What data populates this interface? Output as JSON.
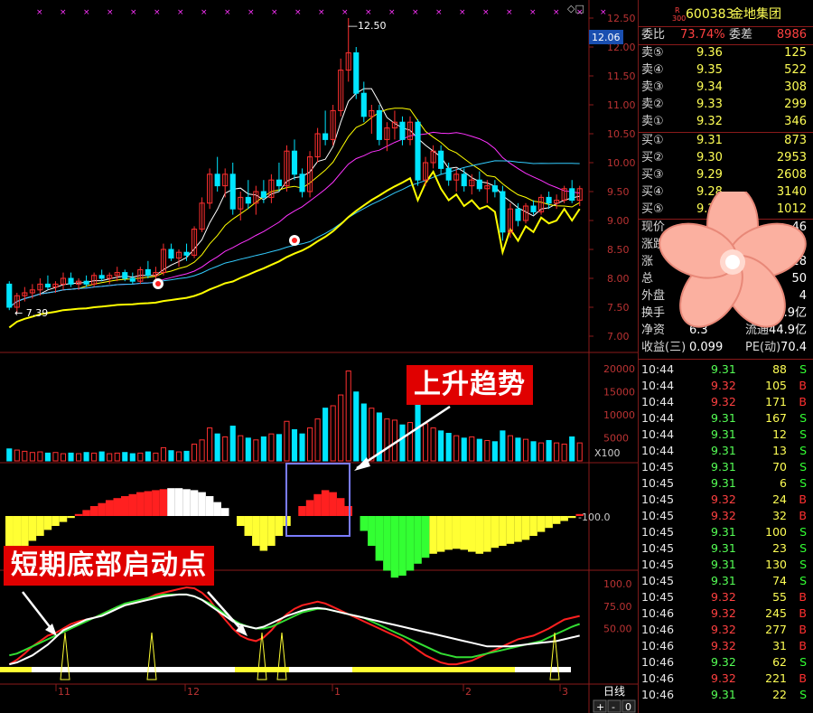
{
  "header": {
    "r_label": "R",
    "code_prefix": "300",
    "code": "600383",
    "name": "金地集团"
  },
  "order_ratio": {
    "label1": "委比",
    "value1": "73.74%",
    "label2": "委差",
    "value2": "8986"
  },
  "sell": [
    {
      "label": "卖⑤",
      "price": "9.36",
      "vol": "125"
    },
    {
      "label": "卖④",
      "price": "9.35",
      "vol": "522"
    },
    {
      "label": "卖③",
      "price": "9.34",
      "vol": "308"
    },
    {
      "label": "卖②",
      "price": "9.33",
      "vol": "299"
    },
    {
      "label": "卖①",
      "price": "9.32",
      "vol": "346"
    }
  ],
  "buy": [
    {
      "label": "买①",
      "price": "9.31",
      "vol": "873"
    },
    {
      "label": "买②",
      "price": "9.30",
      "vol": "2953"
    },
    {
      "label": "买③",
      "price": "9.29",
      "vol": "2608"
    },
    {
      "label": "买④",
      "price": "9.28",
      "vol": "3140"
    },
    {
      "label": "买⑤",
      "price": "9.27",
      "vol": "1012"
    }
  ],
  "quote": [
    {
      "l1": "现价",
      "v1": "",
      "l2": "",
      "v2": "46"
    },
    {
      "l1": "涨跌",
      "v1": "",
      "l2": "",
      "v2": "9.51"
    },
    {
      "l1": "涨",
      "v1": "",
      "l2": "",
      "v2": "9.28"
    },
    {
      "l1": "总",
      "v1": "",
      "l2": "",
      "v2": "50"
    },
    {
      "l1": "外盘",
      "v1": "7",
      "l2": "",
      "v2": "4"
    },
    {
      "l1": "换手",
      "v1": "0.",
      "l2": "本",
      "v2": "44.9亿"
    },
    {
      "l1": "净资",
      "v1": "6.3",
      "l2": "流通",
      "v2": "44.9亿"
    },
    {
      "l1": "收益(三)",
      "v1": "0.099",
      "l2": "PE(动)",
      "v2": "70.4"
    }
  ],
  "ticks": [
    {
      "time": "10:44",
      "price": "9.31",
      "vol": "88",
      "dir": "S"
    },
    {
      "time": "10:44",
      "price": "9.32",
      "vol": "105",
      "dir": "B"
    },
    {
      "time": "10:44",
      "price": "9.32",
      "vol": "171",
      "dir": "B"
    },
    {
      "time": "10:44",
      "price": "9.31",
      "vol": "167",
      "dir": "S"
    },
    {
      "time": "10:44",
      "price": "9.31",
      "vol": "12",
      "dir": "S"
    },
    {
      "time": "10:44",
      "price": "9.31",
      "vol": "13",
      "dir": "S"
    },
    {
      "time": "10:45",
      "price": "9.31",
      "vol": "70",
      "dir": "S"
    },
    {
      "time": "10:45",
      "price": "9.31",
      "vol": "6",
      "dir": "S"
    },
    {
      "time": "10:45",
      "price": "9.32",
      "vol": "24",
      "dir": "B"
    },
    {
      "time": "10:45",
      "price": "9.32",
      "vol": "32",
      "dir": "B"
    },
    {
      "time": "10:45",
      "price": "9.31",
      "vol": "100",
      "dir": "S"
    },
    {
      "time": "10:45",
      "price": "9.31",
      "vol": "23",
      "dir": "S"
    },
    {
      "time": "10:45",
      "price": "9.31",
      "vol": "130",
      "dir": "S"
    },
    {
      "time": "10:45",
      "price": "9.31",
      "vol": "74",
      "dir": "S"
    },
    {
      "time": "10:45",
      "price": "9.32",
      "vol": "55",
      "dir": "B"
    },
    {
      "time": "10:46",
      "price": "9.32",
      "vol": "245",
      "dir": "B"
    },
    {
      "time": "10:46",
      "price": "9.32",
      "vol": "277",
      "dir": "B"
    },
    {
      "time": "10:46",
      "price": "9.32",
      "vol": "31",
      "dir": "B"
    },
    {
      "time": "10:46",
      "price": "9.32",
      "vol": "62",
      "dir": "S"
    },
    {
      "time": "10:46",
      "price": "9.32",
      "vol": "221",
      "dir": "B"
    },
    {
      "time": "10:46",
      "price": "9.31",
      "vol": "22",
      "dir": "S"
    }
  ],
  "colors": {
    "up": "#ff3030",
    "down": "#00e5ff",
    "sell_dir": "#33ff33",
    "buy_dir": "#ff3030",
    "banner": "#e00000"
  },
  "chart_labels": {
    "high_label": "12.50",
    "low_label": "7.39",
    "current_price": "12.06",
    "vol_unit": "X100",
    "macd_level": "-100.0",
    "period_label": "日线",
    "zoom_plus": "+",
    "zoom_minus": "-",
    "zoom_zero": "0",
    "window_icons": "◇□"
  },
  "annotations": {
    "uptrend": "上升趋势",
    "short_bottom": "短期底部启动点"
  },
  "chart_data": [
    {
      "type": "candlestick",
      "yticks": [
        "12.50",
        "12.00",
        "11.50",
        "11.00",
        "10.50",
        "10.00",
        "9.50",
        "9.00",
        "8.50",
        "8.00",
        "7.50",
        "7.00"
      ],
      "ylim": [
        7.0,
        12.5
      ],
      "xticks": [
        "11",
        "12",
        "1",
        "2",
        "3"
      ],
      "ohlc": [
        [
          7.9,
          7.95,
          7.45,
          7.5
        ],
        [
          7.5,
          7.75,
          7.4,
          7.7
        ],
        [
          7.7,
          7.85,
          7.6,
          7.75
        ],
        [
          7.75,
          7.9,
          7.65,
          7.8
        ],
        [
          7.8,
          8.0,
          7.7,
          7.9
        ],
        [
          7.9,
          8.05,
          7.8,
          7.85
        ],
        [
          7.85,
          7.95,
          7.75,
          7.9
        ],
        [
          7.9,
          8.1,
          7.8,
          8.0
        ],
        [
          8.0,
          8.1,
          7.85,
          7.9
        ],
        [
          7.9,
          8.0,
          7.8,
          7.95
        ],
        [
          7.95,
          8.05,
          7.85,
          7.9
        ],
        [
          7.9,
          8.1,
          7.85,
          8.05
        ],
        [
          8.05,
          8.15,
          7.95,
          8.0
        ],
        [
          8.0,
          8.1,
          7.9,
          8.05
        ],
        [
          8.05,
          8.2,
          7.95,
          8.1
        ],
        [
          8.1,
          8.15,
          7.95,
          8.0
        ],
        [
          8.0,
          8.1,
          7.9,
          7.95
        ],
        [
          7.95,
          8.2,
          7.9,
          8.15
        ],
        [
          8.15,
          8.3,
          8.0,
          8.05
        ],
        [
          8.05,
          8.2,
          7.95,
          8.1
        ],
        [
          8.1,
          8.6,
          8.05,
          8.5
        ],
        [
          8.5,
          8.6,
          8.3,
          8.35
        ],
        [
          8.35,
          8.5,
          8.2,
          8.45
        ],
        [
          8.45,
          8.6,
          8.3,
          8.4
        ],
        [
          8.4,
          8.9,
          8.35,
          8.85
        ],
        [
          8.85,
          9.4,
          8.8,
          9.3
        ],
        [
          9.3,
          9.9,
          9.2,
          9.8
        ],
        [
          9.8,
          10.1,
          9.5,
          9.6
        ],
        [
          9.6,
          9.9,
          9.4,
          9.8
        ],
        [
          9.8,
          10.0,
          9.1,
          9.2
        ],
        [
          9.2,
          9.5,
          9.0,
          9.4
        ],
        [
          9.4,
          9.7,
          9.2,
          9.3
        ],
        [
          9.3,
          9.6,
          9.1,
          9.5
        ],
        [
          9.5,
          9.7,
          9.3,
          9.4
        ],
        [
          9.4,
          9.8,
          9.3,
          9.7
        ],
        [
          9.7,
          10.0,
          9.5,
          9.6
        ],
        [
          9.6,
          10.3,
          9.5,
          10.2
        ],
        [
          10.2,
          10.4,
          9.7,
          9.8
        ],
        [
          9.8,
          9.9,
          9.4,
          9.5
        ],
        [
          9.5,
          10.2,
          9.4,
          10.1
        ],
        [
          10.1,
          10.6,
          10.0,
          10.5
        ],
        [
          10.5,
          10.9,
          10.3,
          10.4
        ],
        [
          10.4,
          11.0,
          10.3,
          10.9
        ],
        [
          10.9,
          11.8,
          10.8,
          11.6
        ],
        [
          11.6,
          12.5,
          11.4,
          11.9
        ],
        [
          11.9,
          12.0,
          11.1,
          11.2
        ],
        [
          11.2,
          11.4,
          10.7,
          10.8
        ],
        [
          10.8,
          11.0,
          10.5,
          10.9
        ],
        [
          10.9,
          11.0,
          10.3,
          10.4
        ],
        [
          10.4,
          10.7,
          10.2,
          10.6
        ],
        [
          10.6,
          10.9,
          10.4,
          10.7
        ],
        [
          10.7,
          10.8,
          10.3,
          10.4
        ],
        [
          10.4,
          10.8,
          10.3,
          10.7
        ],
        [
          10.7,
          10.75,
          9.6,
          9.7
        ],
        [
          9.7,
          10.1,
          9.6,
          10.0
        ],
        [
          10.0,
          10.3,
          9.9,
          10.2
        ],
        [
          10.2,
          10.3,
          9.8,
          9.9
        ],
        [
          9.9,
          10.0,
          9.6,
          9.7
        ],
        [
          9.7,
          9.9,
          9.5,
          9.8
        ],
        [
          9.8,
          9.9,
          9.5,
          9.6
        ],
        [
          9.6,
          9.8,
          9.45,
          9.7
        ],
        [
          9.7,
          9.85,
          9.5,
          9.55
        ],
        [
          9.55,
          9.7,
          9.3,
          9.6
        ],
        [
          9.6,
          9.7,
          9.4,
          9.5
        ],
        [
          9.5,
          9.6,
          8.65,
          8.8
        ],
        [
          8.8,
          9.3,
          8.7,
          9.2
        ],
        [
          9.2,
          9.3,
          8.9,
          9.0
        ],
        [
          9.0,
          9.3,
          8.95,
          9.25
        ],
        [
          9.25,
          9.35,
          9.1,
          9.15
        ],
        [
          9.15,
          9.45,
          9.1,
          9.4
        ],
        [
          9.4,
          9.5,
          9.2,
          9.3
        ],
        [
          9.3,
          9.45,
          9.2,
          9.35
        ],
        [
          9.35,
          9.6,
          9.3,
          9.55
        ],
        [
          9.55,
          9.7,
          9.3,
          9.35
        ],
        [
          9.35,
          9.6,
          9.25,
          9.55
        ]
      ],
      "volume": [
        20,
        18,
        16,
        14,
        15,
        13,
        14,
        12,
        13,
        12,
        14,
        13,
        15,
        12,
        13,
        14,
        12,
        13,
        15,
        13,
        22,
        17,
        15,
        16,
        28,
        35,
        55,
        45,
        40,
        58,
        42,
        38,
        35,
        40,
        45,
        44,
        66,
        52,
        45,
        55,
        70,
        88,
        92,
        110,
        150,
        115,
        95,
        88,
        80,
        70,
        68,
        60,
        64,
        100,
        62,
        55,
        50,
        46,
        42,
        38,
        40,
        36,
        34,
        32,
        50,
        42,
        38,
        36,
        32,
        30,
        34,
        30,
        28,
        40,
        30
      ],
      "macd_hist": [
        -0.3,
        -0.32,
        -0.3,
        -0.25,
        -0.2,
        -0.14,
        -0.1,
        -0.06,
        -0.02,
        0.02,
        0.06,
        0.1,
        0.13,
        0.16,
        0.18,
        0.2,
        0.22,
        0.24,
        0.25,
        0.26,
        0.27,
        0.28,
        0.28,
        0.27,
        0.26,
        0.24,
        0.2,
        0.14,
        0.08,
        0.0,
        -0.1,
        -0.2,
        -0.3,
        -0.35,
        -0.3,
        -0.2,
        -0.1,
        0.0,
        0.1,
        0.16,
        0.22,
        0.26,
        0.24,
        0.18,
        0.1,
        0.0,
        -0.15,
        -0.3,
        -0.45,
        -0.55,
        -0.62,
        -0.6,
        -0.55,
        -0.48,
        -0.42,
        -0.38,
        -0.36,
        -0.34,
        -0.33,
        -0.34,
        -0.36,
        -0.38,
        -0.36,
        -0.32,
        -0.3,
        -0.28,
        -0.26,
        -0.24,
        -0.2,
        -0.16,
        -0.12,
        -0.08,
        -0.05,
        -0.02,
        0.02
      ],
      "kdj_k": [
        10,
        15,
        22,
        30,
        36,
        42,
        45,
        50,
        55,
        58,
        60,
        62,
        66,
        70,
        74,
        76,
        78,
        80,
        84,
        88,
        90,
        92,
        94,
        96,
        95,
        90,
        82,
        70,
        60,
        50,
        42,
        38,
        36,
        40,
        48,
        58,
        66,
        72,
        76,
        78,
        80,
        78,
        74,
        70,
        66,
        62,
        58,
        54,
        50,
        46,
        42,
        38,
        32,
        26,
        20,
        16,
        12,
        10,
        10,
        12,
        14,
        18,
        22,
        26,
        30,
        34,
        38,
        40,
        42,
        46,
        50,
        55,
        60,
        62,
        64
      ],
      "kdj_d": [
        20,
        22,
        26,
        30,
        34,
        38,
        42,
        46,
        50,
        54,
        58,
        62,
        66,
        70,
        74,
        78,
        80,
        82,
        84,
        86,
        88,
        88,
        88,
        88,
        86,
        82,
        78,
        72,
        66,
        60,
        55,
        52,
        50,
        50,
        52,
        56,
        60,
        64,
        68,
        70,
        72,
        72,
        70,
        68,
        66,
        64,
        62,
        58,
        54,
        50,
        46,
        42,
        38,
        34,
        30,
        26,
        22,
        20,
        18,
        18,
        18,
        20,
        22,
        24,
        26,
        28,
        30,
        32,
        34,
        36,
        40,
        44,
        48,
        52,
        55
      ],
      "kdj_j": [
        10,
        12,
        16,
        20,
        26,
        32,
        40,
        48,
        52,
        56,
        60,
        62,
        64,
        68,
        72,
        76,
        78,
        80,
        82,
        84,
        86,
        87,
        88,
        88,
        86,
        82,
        76,
        70,
        64,
        58,
        54,
        52,
        50,
        52,
        56,
        60,
        64,
        67,
        70,
        72,
        73,
        72,
        70,
        68,
        66,
        64,
        62,
        60,
        58,
        56,
        54,
        52,
        50,
        48,
        46,
        44,
        42,
        40,
        38,
        36,
        34,
        32,
        30,
        30,
        30,
        30,
        31,
        32,
        33,
        34,
        35,
        36,
        38,
        40,
        42
      ],
      "kdj_ylim": [
        0,
        100
      ],
      "kdj_yticks": [
        "100.0",
        "75.00",
        "50.00"
      ],
      "vol_yticks": [
        "20000",
        "15000",
        "10000",
        "5000"
      ]
    }
  ]
}
